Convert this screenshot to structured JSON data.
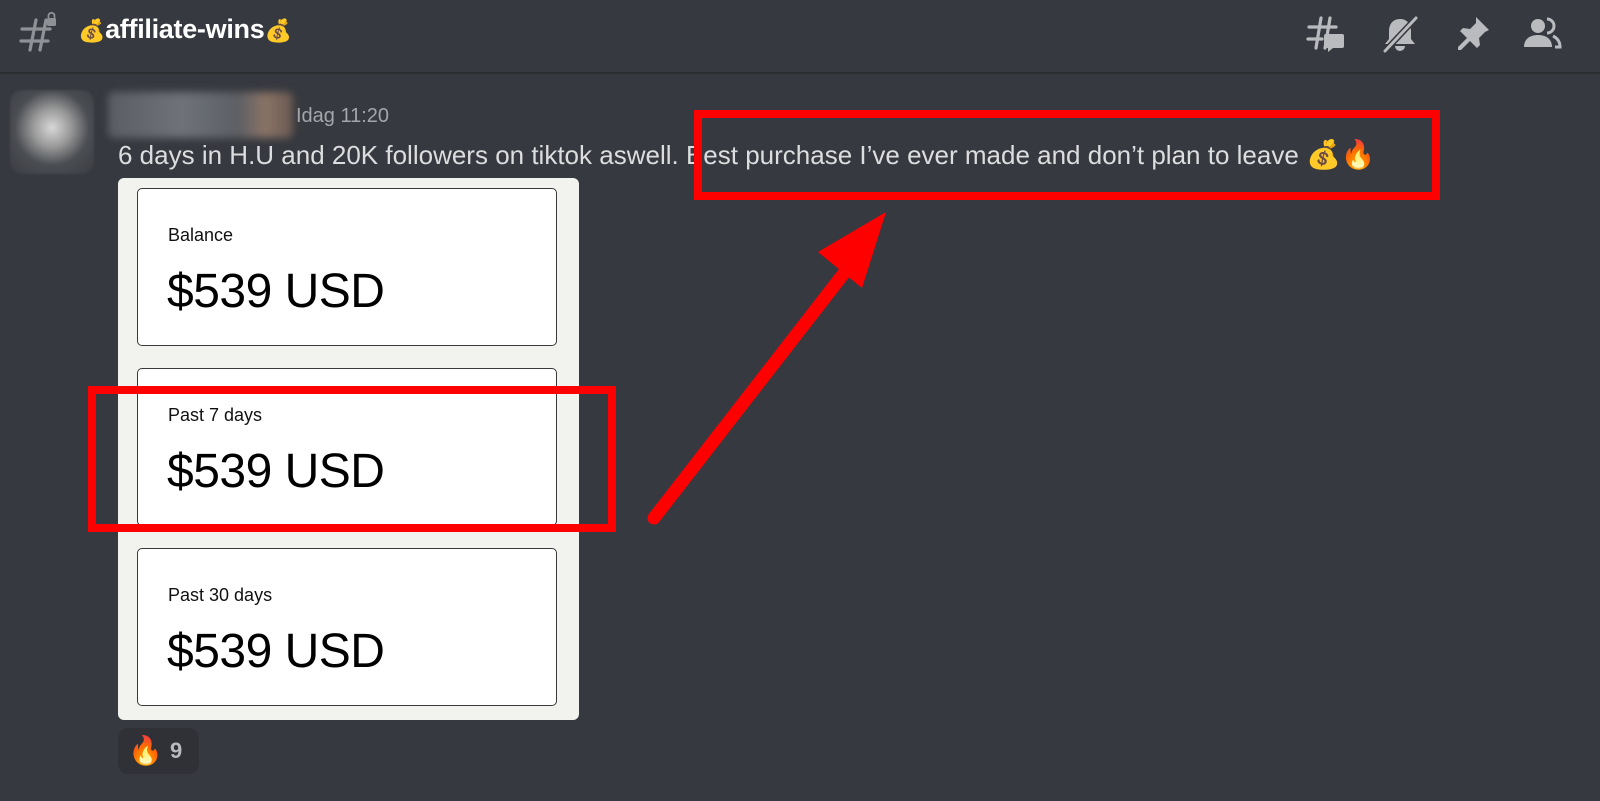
{
  "header": {
    "channel_prefix_emoji": "💰",
    "channel_name": "affiliate-wins",
    "channel_suffix_emoji": "💰",
    "icons": [
      "threads-icon",
      "mute-bell-icon",
      "pin-icon",
      "members-icon"
    ]
  },
  "message": {
    "timestamp": "Idag 11:20",
    "text_part1": "6 days in H.U and 20K followers on tiktok aswell.",
    "text_part2": "Best purchase I’ve ever made and don’t plan to leave",
    "text_emojis": "💰🔥",
    "attachment": {
      "cards": [
        {
          "label": "Balance",
          "value": "$539 USD"
        },
        {
          "label": "Past 7 days",
          "value": "$539 USD"
        },
        {
          "label": "Past 30 days",
          "value": "$539 USD"
        }
      ]
    },
    "reaction": {
      "emoji": "🔥",
      "count": "9"
    }
  },
  "annotation_color": "#ff0000"
}
